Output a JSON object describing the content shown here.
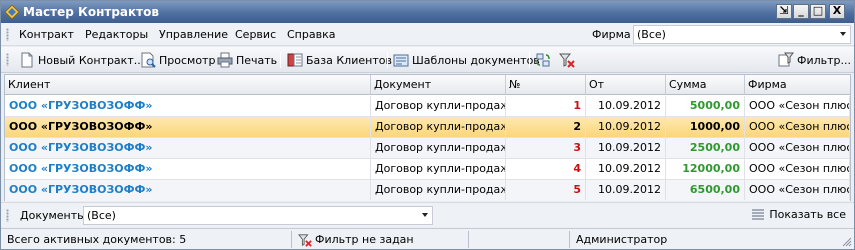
{
  "window": {
    "title": "Мастер Контрактов",
    "buttons": [
      "⇲",
      "_",
      "□",
      "X"
    ]
  },
  "menu": {
    "items": [
      "Контракт",
      "Редакторы",
      "Управление",
      "Сервис",
      "Справка"
    ],
    "firm_label": "Фирма",
    "firm_value": "(Все)"
  },
  "toolbar": {
    "new_contract": "Новый Контракт...",
    "preview": "Просмотр",
    "print": "Печать",
    "clients_db": "База Клиентов",
    "doc_templates": "Шаблоны документов",
    "filter": "Фильтр..."
  },
  "table": {
    "columns": [
      "Клиент",
      "Документ",
      "№",
      "От",
      "Сумма",
      "Фирма"
    ],
    "rows": [
      {
        "client": "ООО «ГРУЗОВОЗОФФ»",
        "document": "Договор купли-продажи",
        "num": "1",
        "date": "10.09.2012",
        "sum": "5000,00",
        "firm": "ООО «Сезон плюс»"
      },
      {
        "client": "ООО «ГРУЗОВОЗОФФ»",
        "document": "Договор купли-продажи",
        "num": "2",
        "date": "10.09.2012",
        "sum": "1000,00",
        "firm": "ООО «Сезон плюс»"
      },
      {
        "client": "ООО «ГРУЗОВОЗОФФ»",
        "document": "Договор купли-продажи",
        "num": "3",
        "date": "10.09.2012",
        "sum": "2500,00",
        "firm": "ООО «Сезон плюс»"
      },
      {
        "client": "ООО «ГРУЗОВОЗОФФ»",
        "document": "Договор купли-продажи",
        "num": "4",
        "date": "10.09.2012",
        "sum": "12000,00",
        "firm": "ООО «Сезон плюс»"
      },
      {
        "client": "ООО «ГРУЗОВОЗОФФ»",
        "document": "Договор купли-продажи",
        "num": "5",
        "date": "10.09.2012",
        "sum": "6500,00",
        "firm": "ООО «Сезон плюс»"
      }
    ],
    "selected_row": 1
  },
  "bottom": {
    "documents_label": "Документы",
    "documents_value": "(Все)",
    "show_all": "Показать все"
  },
  "status": {
    "active_docs": "Всего активных документов: 5",
    "filter_state": "Фильтр не задан",
    "user": "Администратор"
  },
  "colors": {
    "title_bar": "#4f70a0",
    "client_link": "#1f7fc6",
    "number": "#cc1111",
    "sum": "#2e9a2e",
    "selection": "#fbd67a"
  }
}
